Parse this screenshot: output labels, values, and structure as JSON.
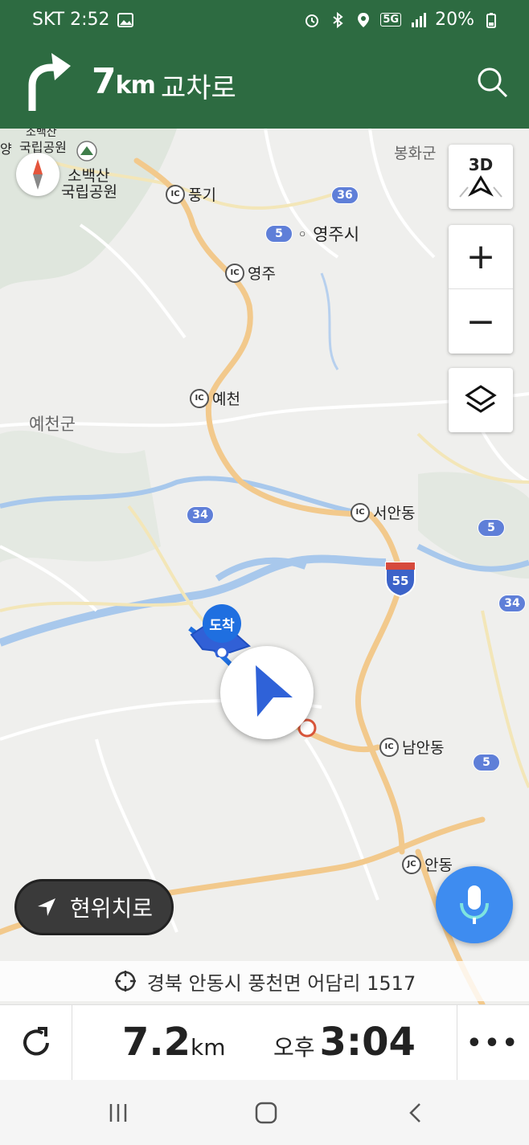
{
  "status": {
    "carrier_time": "SKT 2:52",
    "battery": "20%",
    "network": "5G"
  },
  "nav": {
    "distance_value": "7",
    "distance_unit": "km",
    "road": "교차로",
    "search_icon": "search-icon"
  },
  "map": {
    "labels": {
      "sobaeksan1": "소백산",
      "gukrip1": "국립공원",
      "sobaeksan2": "소백산",
      "gukrip2": "국립공원",
      "bonghwa": "봉화군",
      "yeongju_si": "영주시",
      "yecheon_gun": "예천군",
      "yang": "양"
    },
    "ic": {
      "pungi": "풍기",
      "yeongju": "영주",
      "yecheon": "예천",
      "seoandong": "서안동",
      "namandong": "남안동",
      "andong": "안동"
    },
    "ic_badge": "IC",
    "jc_badge": "JC",
    "routes": {
      "r36": "36",
      "r5a": "5",
      "r34a": "34",
      "r5b": "5",
      "r55": "55",
      "r34b": "34",
      "r5c": "5"
    },
    "controls": {
      "three_d": "3D",
      "zoom_in": "+",
      "zoom_out": "−"
    },
    "destination": "도착"
  },
  "locate_button": "현위치로",
  "address": "경북 안동시 풍천면 어담리 1517",
  "bottom": {
    "remaining_value": "7.2",
    "remaining_unit": "km",
    "eta_period": "오후",
    "eta_time": "3:04",
    "more": "•••"
  },
  "colors": {
    "header": "#2d6b41",
    "route": "#5f7fd8",
    "accent": "#1f6fe0"
  }
}
